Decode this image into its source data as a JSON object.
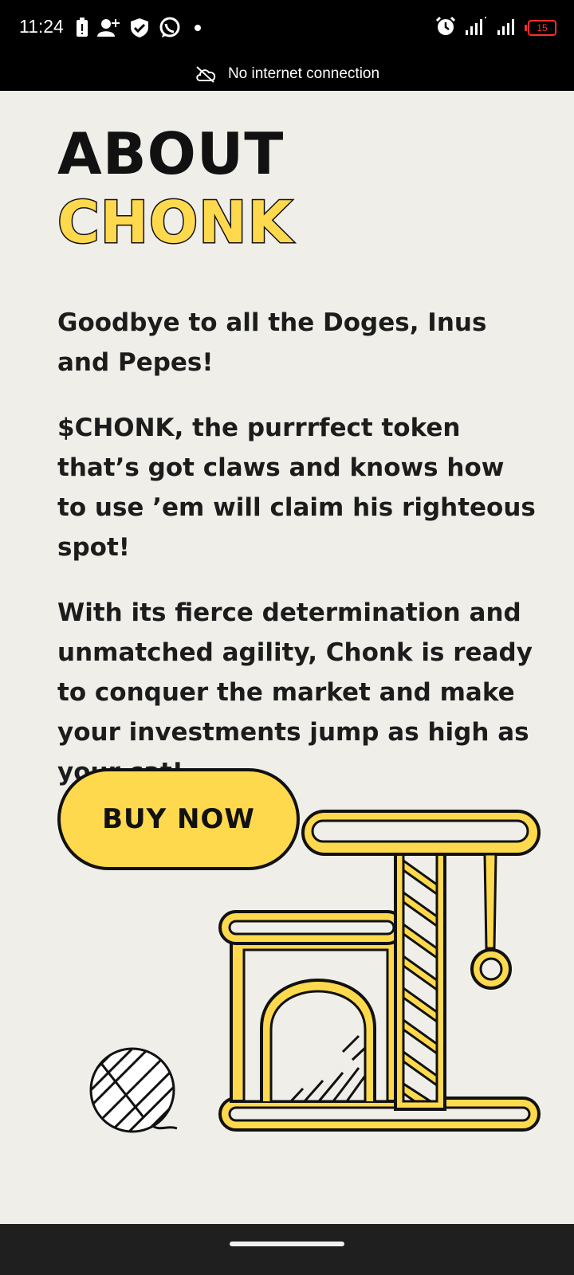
{
  "status_bar": {
    "time": "11:24",
    "battery": "15"
  },
  "banner": {
    "text": "No internet connection"
  },
  "page": {
    "title_part1": "ABOUT",
    "title_part2": "CHONK",
    "paragraphs": [
      "Goodbye to all the Doges, Inus and Pepes!",
      "$CHONK, the purrrfect token that’s got claws and knows how to use ’em will claim his righteous spot!",
      "With its fierce determination and unmatched agility, Chonk is ready to conquer the market and make your investments jump as high as your cat!"
    ],
    "buy_button": "BUY NOW"
  },
  "colors": {
    "accent": "#ffd94d",
    "background": "#efeee9",
    "text": "#1c1c1c"
  },
  "icons": {
    "status_left": [
      "battery-alert-icon",
      "add-user-icon",
      "shield-icon",
      "whatsapp-icon",
      "dot-icon"
    ],
    "status_right": [
      "alarm-icon",
      "signal-icon",
      "signal-icon"
    ],
    "banner": "cloud-off-icon"
  }
}
